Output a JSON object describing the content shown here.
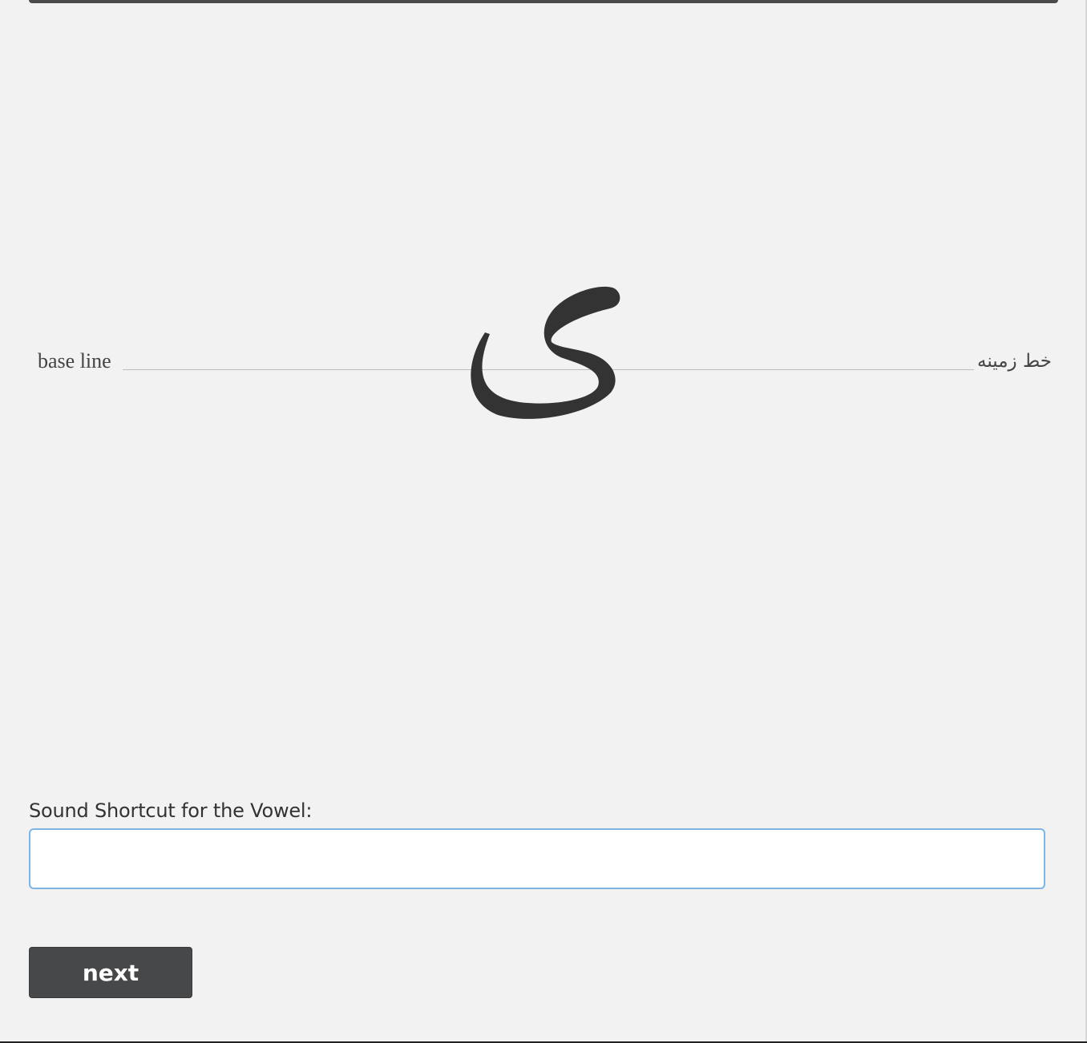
{
  "lesson": {
    "baseline_label_en": "base line",
    "baseline_label_fa": "خط زمینه",
    "letter": "ی"
  },
  "form": {
    "field_label": "Sound Shortcut for the Vowel:",
    "input_value": "",
    "next_label": "next"
  }
}
